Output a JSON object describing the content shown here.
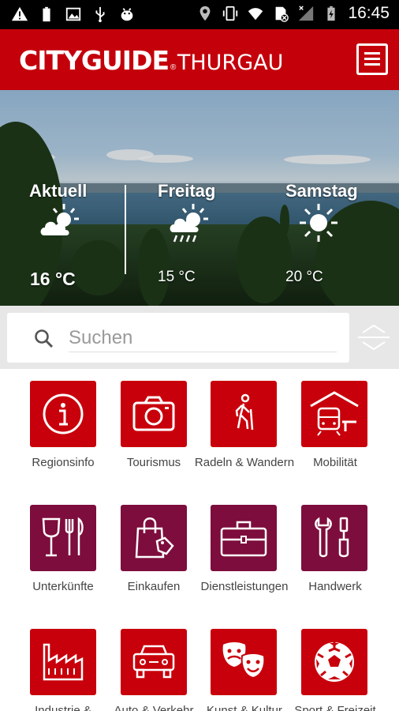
{
  "status_bar": {
    "time": "16:45",
    "left_icons": [
      "warning-icon",
      "battery-full-icon",
      "image-icon",
      "usb-icon",
      "android-debug-icon"
    ],
    "right_icons": [
      "location-icon",
      "vibrate-icon",
      "wifi-icon",
      "no-sim-icon",
      "signal-icon",
      "battery-charging-icon"
    ]
  },
  "app_bar": {
    "logo_brand": "CITYGUIDE",
    "logo_region": "THURGAU",
    "menu_icon": "hamburger-menu-icon",
    "accent_color": "#c4000b"
  },
  "weather": [
    {
      "day": "Aktuell",
      "temp": "16 °C",
      "icon": "sun-cloud-icon"
    },
    {
      "day": "Freitag",
      "temp": "15 °C",
      "icon": "sun-rain-icon"
    },
    {
      "day": "Samstag",
      "temp": "20 °C",
      "icon": "sun-icon"
    }
  ],
  "search": {
    "placeholder": "Suchen",
    "value": "",
    "search_icon": "search-icon",
    "sort_icon": "sort-toggle-icon"
  },
  "categories": [
    {
      "label": "Regionsinfo",
      "icon": "info-icon",
      "color": "#c8000b"
    },
    {
      "label": "Tourismus",
      "icon": "camera-icon",
      "color": "#c8000b"
    },
    {
      "label": "Radeln & Wandern",
      "icon": "hiker-icon",
      "color": "#c8000b"
    },
    {
      "label": "Mobilität",
      "icon": "train-station-icon",
      "color": "#c8000b"
    },
    {
      "label": "Unterkünfte",
      "icon": "wine-cutlery-icon",
      "color": "#7d0d3c"
    },
    {
      "label": "Einkaufen",
      "icon": "shopping-bag-icon",
      "color": "#7d0d3c"
    },
    {
      "label": "Dienstleistungen",
      "icon": "briefcase-icon",
      "color": "#7d0d3c"
    },
    {
      "label": "Handwerk",
      "icon": "tools-icon",
      "color": "#7d0d3c"
    },
    {
      "label": "Industrie & Gewerbe",
      "icon": "factory-icon",
      "color": "#c8000b"
    },
    {
      "label": "Auto & Verkehr",
      "icon": "car-icon",
      "color": "#c8000b"
    },
    {
      "label": "Kunst & Kultur",
      "icon": "theater-masks-icon",
      "color": "#c8000b"
    },
    {
      "label": "Sport & Freizeit",
      "icon": "soccer-ball-icon",
      "color": "#c8000b"
    }
  ]
}
